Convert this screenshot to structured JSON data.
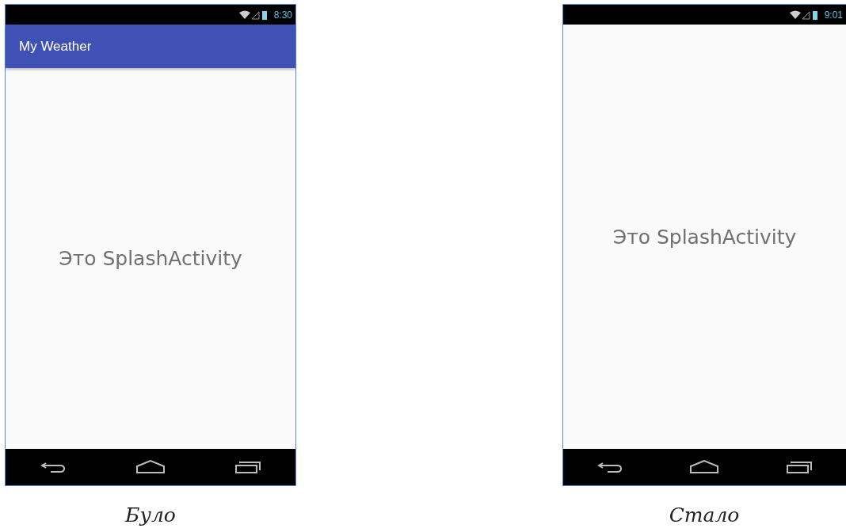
{
  "panels": [
    {
      "status_time": "8:30",
      "app_bar": {
        "title": "My Weather"
      },
      "body_text": "Это SplashActivity",
      "caption": "Було"
    },
    {
      "status_time": "9:01",
      "body_text": "Это SplashActivity",
      "caption": "Стало"
    }
  ]
}
